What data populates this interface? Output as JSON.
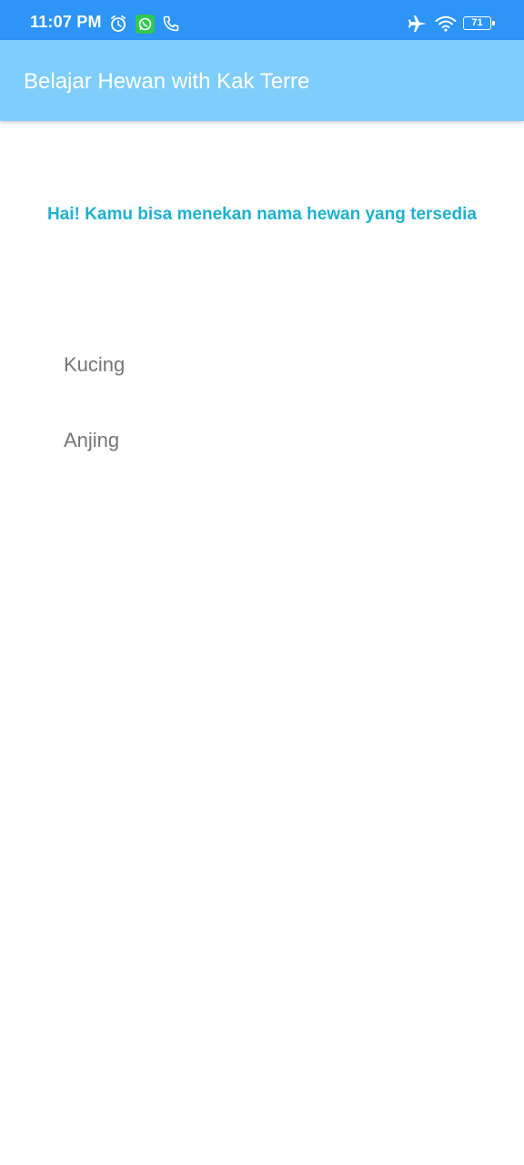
{
  "status_bar": {
    "time": "11:07 PM",
    "battery": "71",
    "icons": [
      "alarm-icon",
      "whatsapp-icon",
      "phone-icon",
      "airplane-mode-icon",
      "wifi-icon",
      "battery-icon"
    ]
  },
  "app_bar": {
    "title": "Belajar Hewan with Kak Terre",
    "color": "#7fcdfb"
  },
  "main": {
    "greeting": "Hai! Kamu bisa menekan nama hewan yang tersedia",
    "greeting_color": "#1fb1cd",
    "animals": [
      {
        "label": "Kucing"
      },
      {
        "label": "Anjing"
      }
    ]
  }
}
